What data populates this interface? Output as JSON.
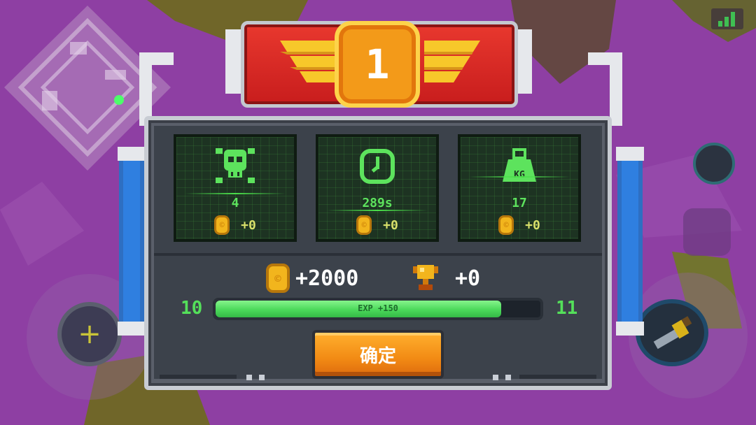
{
  "rank_badge": {
    "number": "1"
  },
  "stats": [
    {
      "name": "kills",
      "icon": "skull-icon",
      "value": "4",
      "reward": "+0"
    },
    {
      "name": "time",
      "icon": "clock-icon",
      "value": "289s",
      "reward": "+0"
    },
    {
      "name": "weight",
      "icon": "weight-icon",
      "value": "17",
      "reward": "+0",
      "icon_text": "KG"
    }
  ],
  "totals": {
    "coins": "+2000",
    "trophies": "+0"
  },
  "experience": {
    "current_level": "10",
    "next_level": "11",
    "label": "EXP +150",
    "progress": 0.88
  },
  "confirm_button": {
    "label": "确定"
  },
  "colors": {
    "background": "#8e3fa3",
    "banner_red": "#d8252a",
    "medal_orange": "#f39a19",
    "screen_green": "#5de35d",
    "exp_green": "#4bd95a",
    "button_orange": "#f28a14",
    "coin_gold": "#f2b51d"
  }
}
